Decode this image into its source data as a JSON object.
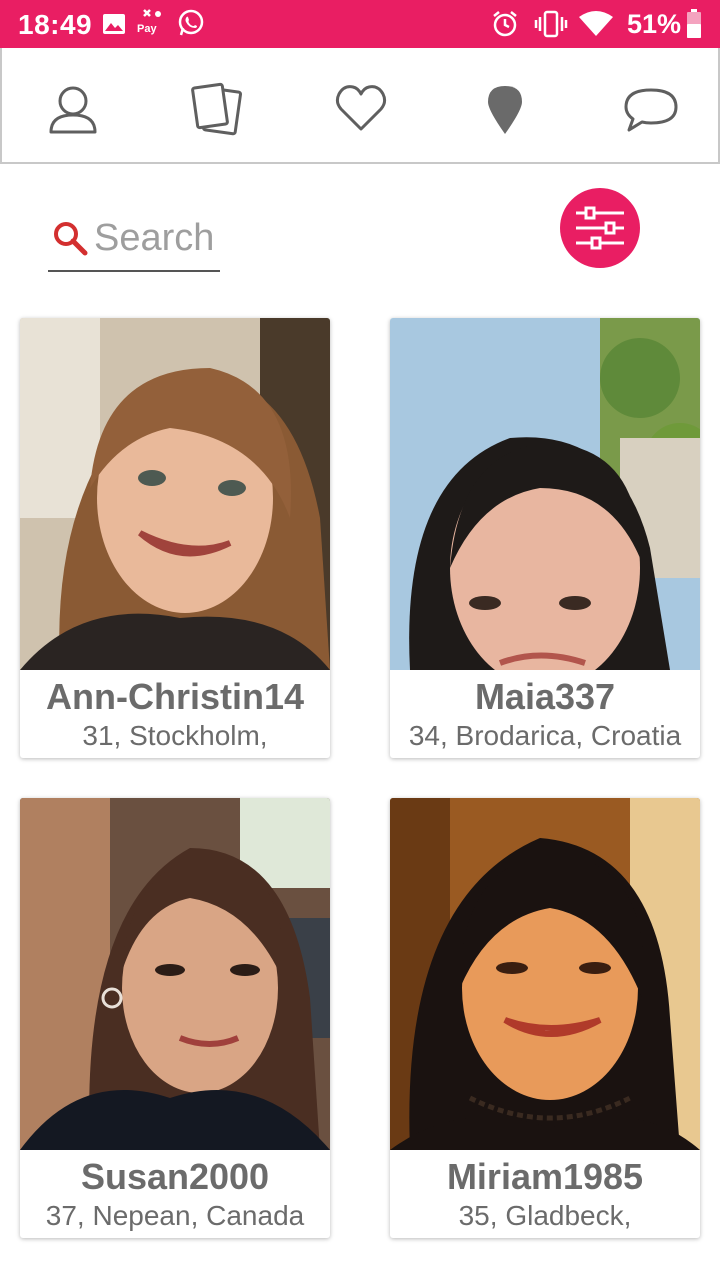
{
  "status_bar": {
    "time": "18:49",
    "battery": "51%",
    "icons": [
      "image-icon",
      "pay-icon",
      "whatsapp-icon",
      "alarm-icon",
      "vibrate-icon",
      "wifi-icon",
      "battery-icon"
    ],
    "pay_label": "Pay",
    "background_color": "#e91e63"
  },
  "nav": {
    "items": [
      {
        "name": "profile",
        "icon": "person-icon"
      },
      {
        "name": "cards",
        "icon": "cards-icon"
      },
      {
        "name": "likes",
        "icon": "heart-icon"
      },
      {
        "name": "nearby",
        "icon": "location-pin-icon",
        "active": true
      },
      {
        "name": "messages",
        "icon": "chat-bubble-icon"
      }
    ]
  },
  "search": {
    "placeholder": "Search",
    "value": ""
  },
  "filter_button": {
    "icon": "sliders-icon",
    "color": "#e91e63"
  },
  "profiles": [
    {
      "name": "Ann-Christin14",
      "details": "31, Stockholm,"
    },
    {
      "name": "Maia337",
      "details": "34, Brodarica, Croatia"
    },
    {
      "name": "Susan2000",
      "details": "37, Nepean, Canada"
    },
    {
      "name": "Miriam1985",
      "details": "35, Gladbeck,"
    }
  ]
}
